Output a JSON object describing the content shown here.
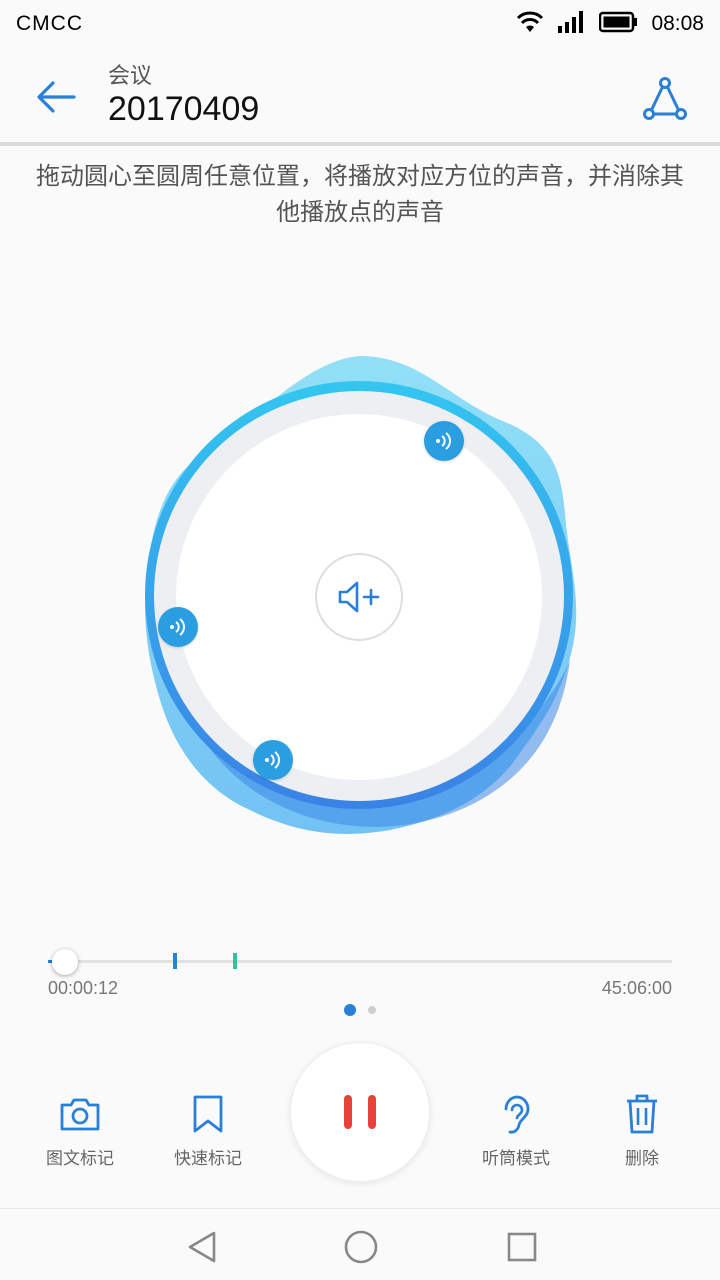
{
  "status": {
    "carrier": "CMCC",
    "time": "08:08"
  },
  "header": {
    "subtitle": "会议",
    "title": "20170409"
  },
  "hint": "拖动圆心至圆周任意位置，将播放对应方位的声音，并消除其他播放点的声音",
  "playback": {
    "current_time": "00:00:12",
    "total_time": "45:06:00",
    "progress": 0.0044
  },
  "pager": {
    "count": 2,
    "active": 0
  },
  "actions": {
    "photo_mark": "图文标记",
    "quick_mark": "快速标记",
    "earpiece_mode": "听筒模式",
    "delete": "删除"
  },
  "colors": {
    "accent": "#2a7fd6",
    "pause": "#e8433a",
    "point": "#2a9ee0",
    "mark_blue": "#2a7fd6",
    "mark_green": "#2ec4a0"
  }
}
